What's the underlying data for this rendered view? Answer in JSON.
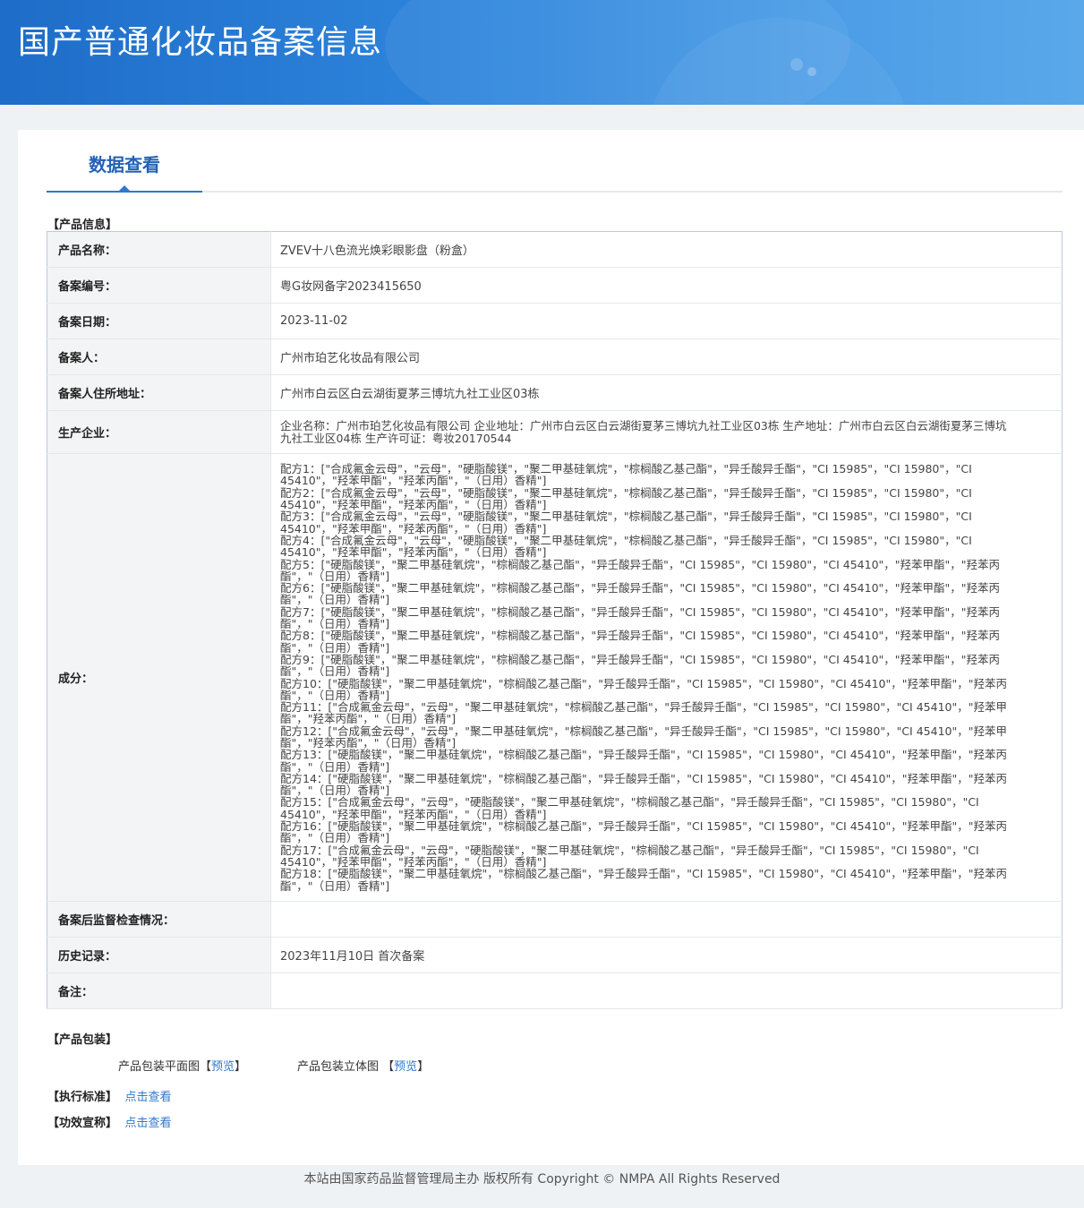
{
  "header": {
    "title": "国产普通化妆品备案信息"
  },
  "tabs": [
    {
      "label": "数据查看",
      "active": true
    }
  ],
  "product_info": {
    "section_label": "【产品信息】",
    "rows": [
      {
        "label": "产品名称：",
        "value": "ZVEV十八色流光焕彩眼影盘（粉盒）"
      },
      {
        "label": "备案编号：",
        "value": "粤G妆网备字2023415650"
      },
      {
        "label": "备案日期：",
        "value": "2023-11-02"
      },
      {
        "label": "备案人：",
        "value": "广州市珀艺化妆品有限公司"
      },
      {
        "label": "备案人住所地址：",
        "value": "广州市白云区白云湖街夏茅三博坑九社工业区03栋"
      },
      {
        "label": "生产企业：",
        "value": "企业名称：广州市珀艺化妆品有限公司 企业地址：广州市白云区白云湖街夏茅三博坑九社工业区03栋 生产地址：广州市白云区白云湖街夏茅三博坑九社工业区04栋 生产许可证：粤妆20170544"
      },
      {
        "label": "成分：",
        "lines": [
          "配方1：[\"合成氟金云母\"，\"云母\"，\"硬脂酸镁\"，\"聚二甲基硅氧烷\"，\"棕榈酸乙基己酯\"，\"异壬酸异壬酯\"，\"CI 15985\"，\"CI 15980\"，\"CI 45410\"，\"羟苯甲酯\"，\"羟苯丙酯\"，\"（日用）香精\"]",
          "配方2：[\"合成氟金云母\"，\"云母\"，\"硬脂酸镁\"，\"聚二甲基硅氧烷\"，\"棕榈酸乙基己酯\"，\"异壬酸异壬酯\"，\"CI 15985\"，\"CI 15980\"，\"CI 45410\"，\"羟苯甲酯\"，\"羟苯丙酯\"，\"（日用）香精\"]",
          "配方3：[\"合成氟金云母\"，\"云母\"，\"硬脂酸镁\"，\"聚二甲基硅氧烷\"，\"棕榈酸乙基己酯\"，\"异壬酸异壬酯\"，\"CI 15985\"，\"CI 15980\"，\"CI 45410\"，\"羟苯甲酯\"，\"羟苯丙酯\"，\"（日用）香精\"]",
          "配方4：[\"合成氟金云母\"，\"云母\"，\"硬脂酸镁\"，\"聚二甲基硅氧烷\"，\"棕榈酸乙基己酯\"，\"异壬酸异壬酯\"，\"CI 15985\"，\"CI 15980\"，\"CI 45410\"，\"羟苯甲酯\"，\"羟苯丙酯\"，\"（日用）香精\"]",
          "配方5：[\"硬脂酸镁\"，\"聚二甲基硅氧烷\"，\"棕榈酸乙基己酯\"，\"异壬酸异壬酯\"，\"CI 15985\"，\"CI 15980\"，\"CI 45410\"，\"羟苯甲酯\"，\"羟苯丙酯\"，\"（日用）香精\"]",
          "配方6：[\"硬脂酸镁\"，\"聚二甲基硅氧烷\"，\"棕榈酸乙基己酯\"，\"异壬酸异壬酯\"，\"CI 15985\"，\"CI 15980\"，\"CI 45410\"，\"羟苯甲酯\"，\"羟苯丙酯\"，\"（日用）香精\"]",
          "配方7：[\"硬脂酸镁\"，\"聚二甲基硅氧烷\"，\"棕榈酸乙基己酯\"，\"异壬酸异壬酯\"，\"CI 15985\"，\"CI 15980\"，\"CI 45410\"，\"羟苯甲酯\"，\"羟苯丙酯\"，\"（日用）香精\"]",
          "配方8：[\"硬脂酸镁\"，\"聚二甲基硅氧烷\"，\"棕榈酸乙基己酯\"，\"异壬酸异壬酯\"，\"CI 15985\"，\"CI 15980\"，\"CI 45410\"，\"羟苯甲酯\"，\"羟苯丙酯\"，\"（日用）香精\"]",
          "配方9：[\"硬脂酸镁\"，\"聚二甲基硅氧烷\"，\"棕榈酸乙基己酯\"，\"异壬酸异壬酯\"，\"CI 15985\"，\"CI 15980\"，\"CI 45410\"，\"羟苯甲酯\"，\"羟苯丙酯\"，\"（日用）香精\"]",
          "配方10：[\"硬脂酸镁\"，\"聚二甲基硅氧烷\"，\"棕榈酸乙基己酯\"，\"异壬酸异壬酯\"，\"CI 15985\"，\"CI 15980\"，\"CI 45410\"，\"羟苯甲酯\"，\"羟苯丙酯\"，\"（日用）香精\"]",
          "配方11：[\"合成氟金云母\"，\"云母\"，\"聚二甲基硅氧烷\"，\"棕榈酸乙基己酯\"，\"异壬酸异壬酯\"，\"CI 15985\"，\"CI 15980\"，\"CI 45410\"，\"羟苯甲酯\"，\"羟苯丙酯\"，\"（日用）香精\"]",
          "配方12：[\"合成氟金云母\"，\"云母\"，\"聚二甲基硅氧烷\"，\"棕榈酸乙基己酯\"，\"异壬酸异壬酯\"，\"CI 15985\"，\"CI 15980\"，\"CI 45410\"，\"羟苯甲酯\"，\"羟苯丙酯\"，\"（日用）香精\"]",
          "配方13：[\"硬脂酸镁\"，\"聚二甲基硅氧烷\"，\"棕榈酸乙基己酯\"，\"异壬酸异壬酯\"，\"CI 15985\"，\"CI 15980\"，\"CI 45410\"，\"羟苯甲酯\"，\"羟苯丙酯\"，\"（日用）香精\"]",
          "配方14：[\"硬脂酸镁\"，\"聚二甲基硅氧烷\"，\"棕榈酸乙基己酯\"，\"异壬酸异壬酯\"，\"CI 15985\"，\"CI 15980\"，\"CI 45410\"，\"羟苯甲酯\"，\"羟苯丙酯\"，\"（日用）香精\"]",
          "配方15：[\"合成氟金云母\"，\"云母\"，\"硬脂酸镁\"，\"聚二甲基硅氧烷\"，\"棕榈酸乙基己酯\"，\"异壬酸异壬酯\"，\"CI 15985\"，\"CI 15980\"，\"CI 45410\"，\"羟苯甲酯\"，\"羟苯丙酯\"，\"（日用）香精\"]",
          "配方16：[\"硬脂酸镁\"，\"聚二甲基硅氧烷\"，\"棕榈酸乙基己酯\"，\"异壬酸异壬酯\"，\"CI 15985\"，\"CI 15980\"，\"CI 45410\"，\"羟苯甲酯\"，\"羟苯丙酯\"，\"（日用）香精\"]",
          "配方17：[\"合成氟金云母\"，\"云母\"，\"硬脂酸镁\"，\"聚二甲基硅氧烷\"，\"棕榈酸乙基己酯\"，\"异壬酸异壬酯\"，\"CI 15985\"，\"CI 15980\"，\"CI 45410\"，\"羟苯甲酯\"，\"羟苯丙酯\"，\"（日用）香精\"]",
          "配方18：[\"硬脂酸镁\"，\"聚二甲基硅氧烷\"，\"棕榈酸乙基己酯\"，\"异壬酸异壬酯\"，\"CI 15985\"，\"CI 15980\"，\"CI 45410\"，\"羟苯甲酯\"，\"羟苯丙酯\"，\"（日用）香精\"]"
        ]
      },
      {
        "label": "备案后监督检查情况：",
        "value": ""
      },
      {
        "label": "历史记录：",
        "value": "2023年11月10日 首次备案"
      },
      {
        "label": "备注：",
        "value": ""
      }
    ]
  },
  "packaging": {
    "section_label": "【产品包装】",
    "flat_label": "产品包装平面图",
    "flat_link": "预览",
    "solid_label": "产品包装立体图",
    "solid_link": "预览",
    "bracket_open": "【",
    "bracket_close": "】"
  },
  "standard": {
    "label": "【执行标准】",
    "link": "点击查看"
  },
  "efficacy": {
    "label": "【功效宣称】",
    "link": "点击查看"
  },
  "footer": {
    "text": "本站由国家药品监督管理局主办 版权所有 Copyright © NMPA All Rights Reserved"
  }
}
